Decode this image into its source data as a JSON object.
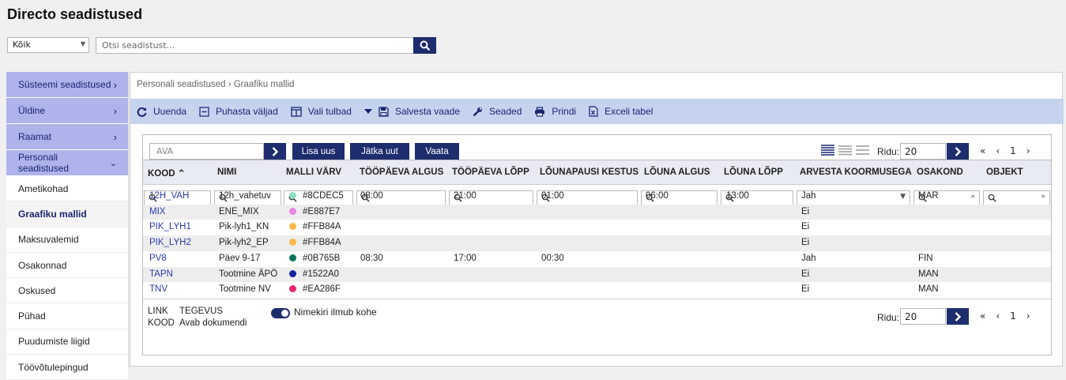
{
  "title": "Directo seadistused",
  "filter": {
    "selected": "Kõik"
  },
  "search": {
    "placeholder": "Otsi seadistust..."
  },
  "sidebar": {
    "top": [
      {
        "label": "Süsteemi seadistused"
      },
      {
        "label": "Üldine"
      },
      {
        "label": "Raamat"
      },
      {
        "label": "Personali seadistused"
      }
    ],
    "sub": [
      {
        "label": "Ametikohad"
      },
      {
        "label": "Graafiku mallid"
      },
      {
        "label": "Maksuvalemid"
      },
      {
        "label": "Osakonnad"
      },
      {
        "label": "Oskused"
      },
      {
        "label": "Pühad"
      },
      {
        "label": "Puudumiste liigid"
      },
      {
        "label": "Töövõtulepingud"
      }
    ]
  },
  "breadcrumb": "Personali seadistused  ›  Graafiku mallid",
  "toolbar": {
    "refresh": "Uuenda",
    "clear": "Puhasta väljad",
    "columns": "Vali tulbad",
    "save_view": "Salvesta vaade",
    "settings": "Seaded",
    "print": "Prindi",
    "excel": "Exceli tabel"
  },
  "grid": {
    "quick_placeholder": "AVA",
    "add_new": "Lisa uus",
    "continue_new": "Jätka uut",
    "view": "Vaata",
    "rows_label": "Ridu:",
    "rows_value": "20",
    "page": "1",
    "columns": [
      "KOOD",
      "NIMI",
      "MALLI VÄRV",
      "TÖÖPÄEVA ALGUS",
      "TÖÖPÄEVA LÕPP",
      "LÕUNAPAUSI KESTUS",
      "LÕUNA ALGUS",
      "LÕUNA LÕPP",
      "ARVESTA KOORMUSEGA",
      "OSAKOND",
      "OBJEKT"
    ],
    "rows": [
      {
        "kood": "12H_VAH",
        "nimi": "12h_vahetuv",
        "varv": "#8CDEC5",
        "algus": "08:00",
        "lopp": "21:00",
        "kestus": "01:00",
        "l_algus": "06:00",
        "l_lopp": "13:00",
        "koormus": "Jah",
        "osakond": "MAR",
        "objekt": ""
      },
      {
        "kood": "MIX",
        "nimi": "ENE_MIX",
        "varv": "#E887E7",
        "algus": "",
        "lopp": "",
        "kestus": "",
        "l_algus": "",
        "l_lopp": "",
        "koormus": "Ei",
        "osakond": "",
        "objekt": ""
      },
      {
        "kood": "PIK_LYH1",
        "nimi": "Pik-lyh1_KN",
        "varv": "#FFB84A",
        "algus": "",
        "lopp": "",
        "kestus": "",
        "l_algus": "",
        "l_lopp": "",
        "koormus": "Ei",
        "osakond": "",
        "objekt": ""
      },
      {
        "kood": "PIK_LYH2",
        "nimi": "Pik-lyh2_EP",
        "varv": "#FFB84A",
        "algus": "",
        "lopp": "",
        "kestus": "",
        "l_algus": "",
        "l_lopp": "",
        "koormus": "Ei",
        "osakond": "",
        "objekt": ""
      },
      {
        "kood": "PV8",
        "nimi": "Päev 9-17",
        "varv": "#0B765B",
        "algus": "08:30",
        "lopp": "17:00",
        "kestus": "00:30",
        "l_algus": "",
        "l_lopp": "",
        "koormus": "Jah",
        "osakond": "FIN",
        "objekt": ""
      },
      {
        "kood": "TAPN",
        "nimi": "Tootmine ÄPÖ",
        "varv": "#1522A0",
        "algus": "",
        "lopp": "",
        "kestus": "",
        "l_algus": "",
        "l_lopp": "",
        "koormus": "Ei",
        "osakond": "MAN",
        "objekt": ""
      },
      {
        "kood": "TNV",
        "nimi": "Tootmine NV",
        "varv": "#EA286F",
        "algus": "",
        "lopp": "",
        "kestus": "",
        "l_algus": "",
        "l_lopp": "",
        "koormus": "Ei",
        "osakond": "MAN",
        "objekt": ""
      }
    ],
    "legend_key_1": "LINK",
    "legend_val_1": "TEGEVUS",
    "legend_key_2": "KOOD",
    "legend_val_2": "Avab dokumendi",
    "toggle_label": "Nimekiri ilmub kohe"
  }
}
